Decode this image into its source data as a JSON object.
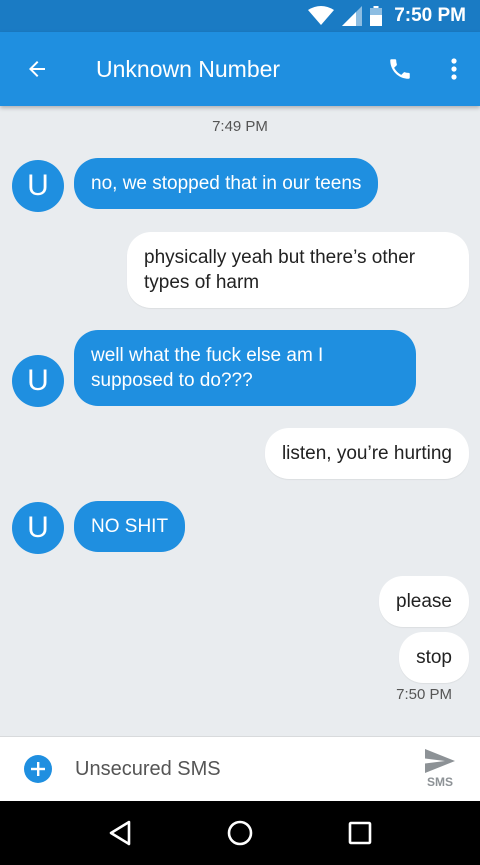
{
  "status_bar": {
    "time": "7:50 PM"
  },
  "header": {
    "title": "Unknown Number"
  },
  "conversation": {
    "timestamp_top": "7:49 PM",
    "messages": [
      {
        "direction": "incoming",
        "avatar_letter": "U",
        "text": "no, we stopped that in our teens"
      },
      {
        "direction": "outgoing",
        "text": "physically yeah but there’s other types of harm"
      },
      {
        "direction": "incoming",
        "avatar_letter": "U",
        "text": "well what the fuck else am I supposed to do???"
      },
      {
        "direction": "outgoing",
        "text": "listen, you’re hurting"
      },
      {
        "direction": "incoming",
        "avatar_letter": "U",
        "text": "NO SHIT"
      },
      {
        "direction": "outgoing",
        "text": "please"
      },
      {
        "direction": "outgoing",
        "text": "stop"
      }
    ],
    "timestamp_bottom": "7:50 PM"
  },
  "composer": {
    "placeholder": "Unsecured SMS",
    "send_label": "SMS"
  },
  "colors": {
    "app_bar": "#1f8fe0",
    "status_bar": "#1a7bc4",
    "incoming_bubble": "#1f8fe0",
    "outgoing_bubble": "#ffffff",
    "background": "#e9ecef"
  }
}
